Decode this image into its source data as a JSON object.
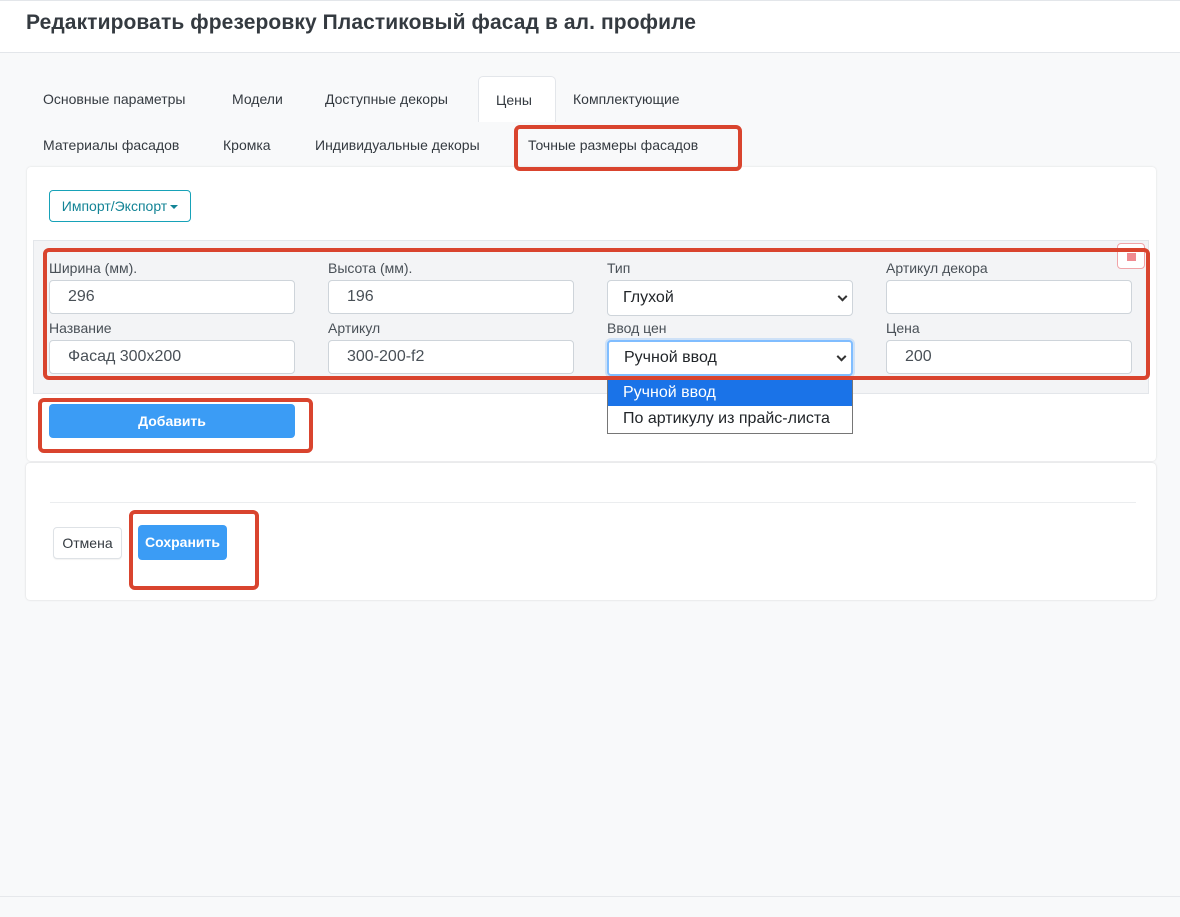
{
  "page": {
    "title": "Редактировать фрезеровку Пластиковый фасад в ал. профиле"
  },
  "tabs": [
    {
      "label": "Основные параметры"
    },
    {
      "label": "Модели"
    },
    {
      "label": "Доступные декоры"
    },
    {
      "label": "Цены",
      "active": true
    },
    {
      "label": "Комплектующие"
    },
    {
      "label": "Материалы фасадов"
    },
    {
      "label": "Кромка"
    },
    {
      "label": "Индивидуальные декоры"
    },
    {
      "label": "Точные размеры фасадов"
    }
  ],
  "toolbar": {
    "import_export_label": "Импорт/Экспорт"
  },
  "form": {
    "width_label": "Ширина (мм).",
    "width_value": "296",
    "height_label": "Высота (мм).",
    "height_value": "196",
    "type_label": "Тип",
    "type_value": "Глухой",
    "decor_article_label": "Артикул декора",
    "decor_article_value": "",
    "name_label": "Название",
    "name_value": "Фасад 300x200",
    "article_label": "Артикул",
    "article_value": "300-200-f2",
    "price_input_label": "Ввод цен",
    "price_input_value": "Ручной ввод",
    "price_label": "Цена",
    "price_value": "200"
  },
  "dropdown": {
    "options": [
      "Ручной ввод",
      "По артикулу из прайс-листа"
    ],
    "selected_index": 0
  },
  "actions": {
    "add_label": "Добавить",
    "cancel_label": "Отмена",
    "save_label": "Сохранить"
  },
  "colors": {
    "primary": "#3b9cf5",
    "highlight": "#d9442e",
    "outline_info": "#17a2b8",
    "danger": "#f08a90",
    "dropdown_selected": "#1a73e8"
  }
}
